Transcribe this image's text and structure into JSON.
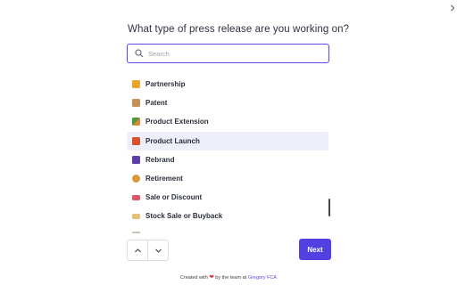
{
  "header": {
    "close_icon": "chevron-right-icon",
    "question": "What type of press release are you working on?"
  },
  "search": {
    "placeholder": "Search",
    "value": "",
    "icon": "search-icon",
    "border_color": "#5b4be0"
  },
  "options": {
    "items": [
      {
        "label": "Partnership",
        "icon": "handshake-emoji",
        "color": "#e8a62b",
        "selected": false
      },
      {
        "label": "Patent",
        "icon": "scroll-emoji",
        "color": "#c9915a",
        "selected": false
      },
      {
        "label": "Product Extension",
        "icon": "chart-arrow-emoji",
        "color": "#4f9a3e",
        "selected": false
      },
      {
        "label": "Product Launch",
        "icon": "gift-emoji",
        "color": "#d9512e",
        "selected": true
      },
      {
        "label": "Rebrand",
        "icon": "sparkle-emoji",
        "color": "#5e3fa8",
        "selected": false
      },
      {
        "label": "Retirement",
        "icon": "person-emoji",
        "color": "#d8993a",
        "selected": false
      },
      {
        "label": "Sale or Discount",
        "icon": "ticket-emoji",
        "color": "#e2566a",
        "selected": false
      },
      {
        "label": "Stock Sale or Buyback",
        "icon": "money-emoji",
        "color": "#e3c27a",
        "selected": false
      }
    ],
    "selected_bg": "#efeefb"
  },
  "navigation": {
    "up_icon": "chevron-up-icon",
    "down_icon": "chevron-down-icon",
    "next_label": "Next",
    "accent": "#5340e0"
  },
  "footer": {
    "prefix": "Created with",
    "heart": "❤",
    "middle": "by the team at",
    "link": "Gregory FCA"
  }
}
